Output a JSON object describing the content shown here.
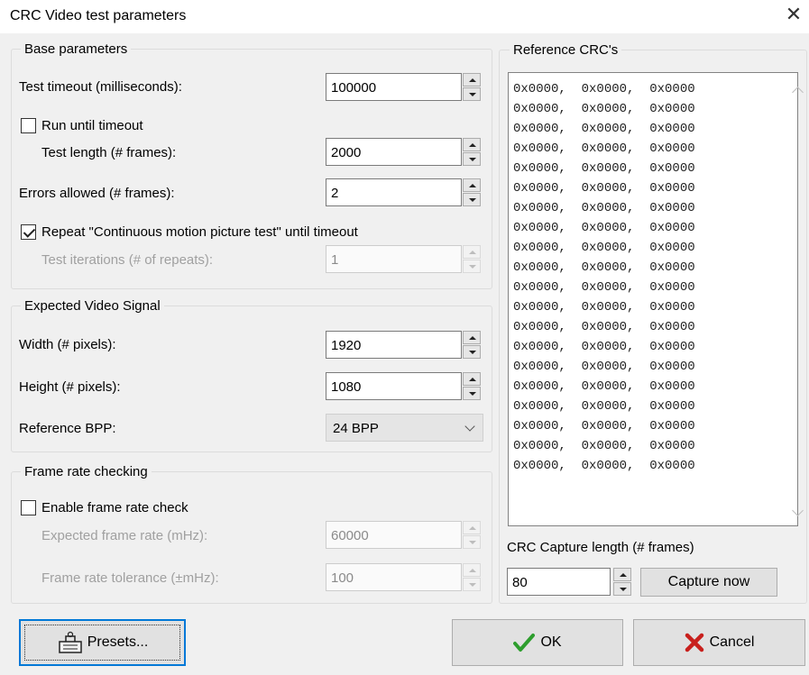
{
  "window": {
    "title": "CRC Video test parameters",
    "close_glyph": "✕"
  },
  "base": {
    "title": "Base parameters",
    "timeout_label": "Test timeout (milliseconds):",
    "timeout_value": "100000",
    "run_until_timeout_label": "Run until timeout",
    "run_until_timeout_checked": false,
    "length_label": "Test length (# frames):",
    "length_value": "2000",
    "errors_label": "Errors allowed (# frames):",
    "errors_value": "2",
    "repeat_label": "Repeat \"Continuous motion picture test\" until timeout",
    "repeat_checked": true,
    "iterations_label": "Test iterations (# of repeats):",
    "iterations_value": "1"
  },
  "signal": {
    "title": "Expected Video Signal",
    "width_label": "Width (# pixels):",
    "width_value": "1920",
    "height_label": "Height (# pixels):",
    "height_value": "1080",
    "bpp_label": "Reference BPP:",
    "bpp_value": "24 BPP"
  },
  "framerate": {
    "title": "Frame rate checking",
    "enable_label": "Enable frame rate check",
    "enable_checked": false,
    "expected_label": "Expected frame rate (mHz):",
    "expected_value": "60000",
    "tolerance_label": "Frame rate tolerance (±mHz):",
    "tolerance_value": "100"
  },
  "reference": {
    "title": "Reference CRC's",
    "rows": [
      "0x0000,  0x0000,  0x0000",
      "0x0000,  0x0000,  0x0000",
      "0x0000,  0x0000,  0x0000",
      "0x0000,  0x0000,  0x0000",
      "0x0000,  0x0000,  0x0000",
      "0x0000,  0x0000,  0x0000",
      "0x0000,  0x0000,  0x0000",
      "0x0000,  0x0000,  0x0000",
      "0x0000,  0x0000,  0x0000",
      "0x0000,  0x0000,  0x0000",
      "0x0000,  0x0000,  0x0000",
      "0x0000,  0x0000,  0x0000",
      "0x0000,  0x0000,  0x0000",
      "0x0000,  0x0000,  0x0000",
      "0x0000,  0x0000,  0x0000",
      "0x0000,  0x0000,  0x0000",
      "0x0000,  0x0000,  0x0000",
      "0x0000,  0x0000,  0x0000",
      "0x0000,  0x0000,  0x0000",
      "0x0000,  0x0000,  0x0000"
    ],
    "capture_length_label": "CRC Capture length (# frames)",
    "capture_length_value": "80",
    "capture_now_label": "Capture now"
  },
  "buttons": {
    "presets_label": "Presets...",
    "ok_label": "OK",
    "cancel_label": "Cancel"
  },
  "colors": {
    "ok_check": "#2e9e2e",
    "cancel_x": "#c8201d",
    "focus_blue": "#0078d7"
  }
}
